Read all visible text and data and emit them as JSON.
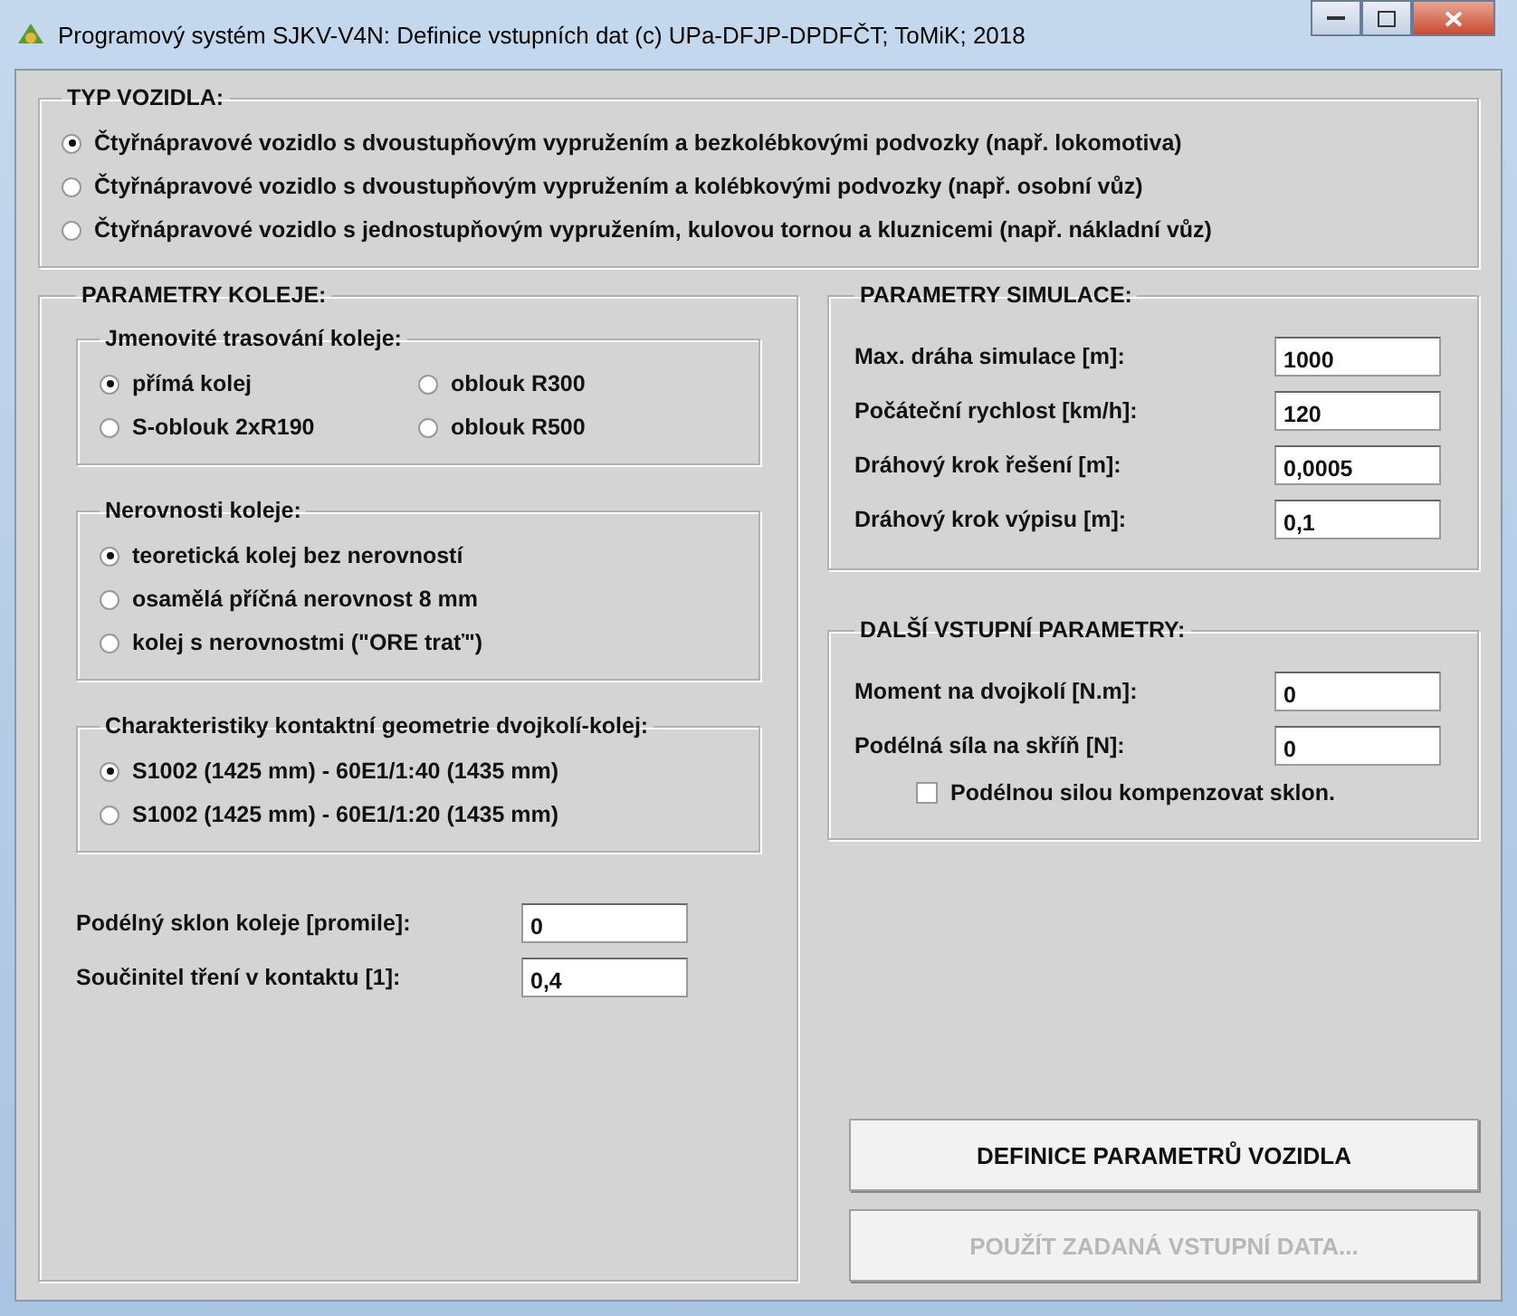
{
  "window": {
    "title": "Programový systém SJKV-V4N: Definice vstupních dat   (c) UPa-DFJP-DPDFČT; ToMiK; 2018"
  },
  "vehicle_type": {
    "title": "TYP VOZIDLA:",
    "options": [
      {
        "label": "Čtyřnápravové vozidlo s dvoustupňovým vypružením a bezkolébkovými podvozky (např. lokomotiva)",
        "selected": true
      },
      {
        "label": "Čtyřnápravové vozidlo s dvoustupňovým vypružením a kolébkovými podvozky (např. osobní vůz)",
        "selected": false
      },
      {
        "label": "Čtyřnápravové vozidlo s jednostupňovým vypružením, kulovou tornou a kluznicemi (např. nákladní vůz)",
        "selected": false
      }
    ]
  },
  "track": {
    "title": "PARAMETRY KOLEJE:",
    "layout": {
      "title": "Jmenovité trasování koleje:",
      "options": [
        {
          "label": "přímá kolej",
          "selected": true
        },
        {
          "label": "oblouk R300",
          "selected": false
        },
        {
          "label": "S-oblouk 2xR190",
          "selected": false
        },
        {
          "label": "oblouk R500",
          "selected": false
        }
      ]
    },
    "irregularities": {
      "title": "Nerovnosti koleje:",
      "options": [
        {
          "label": "teoretická kolej bez nerovností",
          "selected": true
        },
        {
          "label": "osamělá příčná nerovnost 8 mm",
          "selected": false
        },
        {
          "label": "kolej s nerovnostmi (\"ORE trať\")",
          "selected": false
        }
      ]
    },
    "contact_geometry": {
      "title": "Charakteristiky kontaktní geometrie dvojkolí-kolej:",
      "options": [
        {
          "label": "S1002 (1425 mm) - 60E1/1:40 (1435 mm)",
          "selected": true
        },
        {
          "label": "S1002 (1425 mm) - 60E1/1:20 (1435 mm)",
          "selected": false
        }
      ]
    },
    "fields": [
      {
        "label": "Podélný sklon koleje [promile]:",
        "value": "0"
      },
      {
        "label": "Součinitel tření v kontaktu [1]:",
        "value": "0,4"
      }
    ]
  },
  "simulation": {
    "title": "PARAMETRY SIMULACE:",
    "fields": [
      {
        "label": "Max. dráha simulace [m]:",
        "value": "1000"
      },
      {
        "label": "Počáteční rychlost [km/h]:",
        "value": "120"
      },
      {
        "label": "Dráhový krok řešení [m]:",
        "value": "0,0005"
      },
      {
        "label": "Dráhový krok výpisu [m]:",
        "value": "0,1"
      }
    ]
  },
  "other": {
    "title": "DALŠÍ VSTUPNÍ PARAMETRY:",
    "fields": [
      {
        "label": "Moment na dvojkolí [N.m]:",
        "value": "0"
      },
      {
        "label": "Podélná síla na skříň [N]:",
        "value": "0"
      }
    ],
    "checkbox": {
      "label": "Podélnou silou kompenzovat sklon.",
      "checked": false
    }
  },
  "buttons": [
    {
      "label": "DEFINICE PARAMETRŮ VOZIDLA",
      "disabled": false
    },
    {
      "label": "POUŽÍT ZADANÁ VSTUPNÍ DATA...",
      "disabled": true
    }
  ]
}
